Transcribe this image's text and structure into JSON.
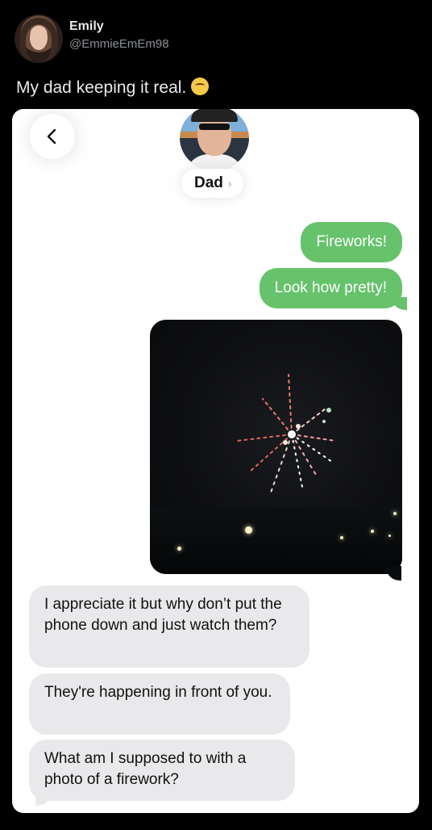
{
  "tweet": {
    "author_name": "Emily",
    "author_handle": "@EmmieEmEm98",
    "text": "My dad keeping it real.",
    "emoji": "loudly-crying-face-icon"
  },
  "screenshot": {
    "contact_name": "Dad",
    "back_icon": "chevron-left-icon",
    "messages": [
      {
        "direction": "outgoing",
        "text": "Fireworks!"
      },
      {
        "direction": "outgoing",
        "text": "Look how pretty!"
      },
      {
        "direction": "outgoing",
        "type": "photo",
        "icon": "fireworks-photo"
      },
      {
        "direction": "incoming",
        "text": "I appreciate it but why don’t put the phone down and just watch them?"
      },
      {
        "direction": "incoming",
        "text": "They're happening in front of you."
      },
      {
        "direction": "incoming",
        "text": "What am I supposed to with a photo of a firework?"
      }
    ]
  },
  "colors": {
    "background": "#000000",
    "outgoing_bubble": "#66c26b",
    "incoming_bubble": "#e9e9eb"
  }
}
